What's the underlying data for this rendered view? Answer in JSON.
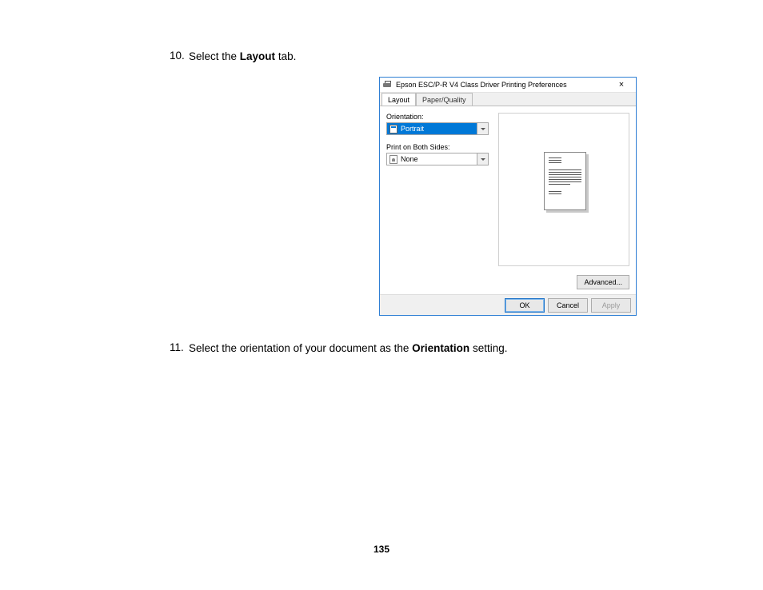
{
  "steps": {
    "step10": {
      "num": "10.",
      "pre": "Select the ",
      "bold": "Layout",
      "post": " tab."
    },
    "step11": {
      "num": "11.",
      "pre": "Select the orientation of your document as the ",
      "bold": "Orientation",
      "post": " setting."
    }
  },
  "dialog": {
    "title": "Epson ESC/P-R V4 Class Driver Printing Preferences",
    "close": "×",
    "tabs": {
      "layout": "Layout",
      "paper_quality": "Paper/Quality"
    },
    "fields": {
      "orientation_label": "Orientation:",
      "orientation_value": "Portrait",
      "both_sides_label": "Print on Both Sides:",
      "both_sides_value": "None"
    },
    "buttons": {
      "advanced": "Advanced...",
      "ok": "OK",
      "cancel": "Cancel",
      "apply": "Apply"
    }
  },
  "page_number": "135"
}
